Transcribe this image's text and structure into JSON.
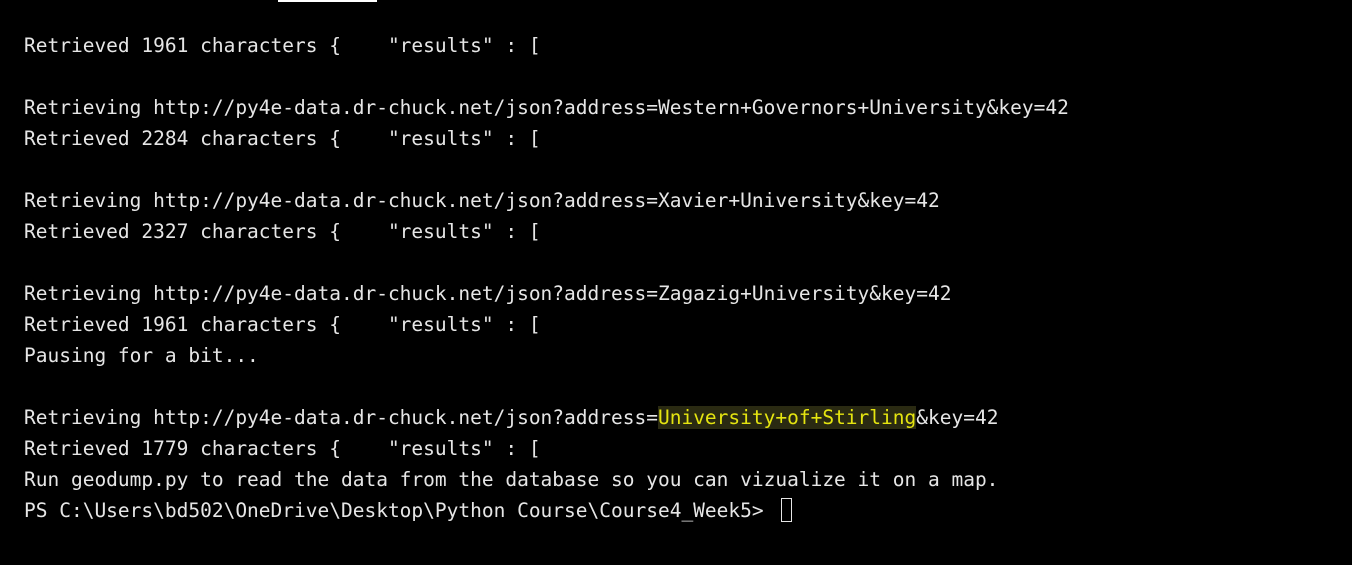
{
  "terminal": {
    "lines": [
      {
        "text": "Retrieved 1961 characters {    \"results\" : ["
      },
      {
        "text": ""
      },
      {
        "text": "Retrieving http://py4e-data.dr-chuck.net/json?address=Western+Governors+University&key=42"
      },
      {
        "text": "Retrieved 2284 characters {    \"results\" : ["
      },
      {
        "text": ""
      },
      {
        "text": "Retrieving http://py4e-data.dr-chuck.net/json?address=Xavier+University&key=42"
      },
      {
        "text": "Retrieved 2327 characters {    \"results\" : ["
      },
      {
        "text": ""
      },
      {
        "text": "Retrieving http://py4e-data.dr-chuck.net/json?address=Zagazig+University&key=42"
      },
      {
        "text": "Retrieved 1961 characters {    \"results\" : ["
      },
      {
        "text": "Pausing for a bit..."
      },
      {
        "text": ""
      },
      {
        "prefix": "Retrieving http://py4e-data.dr-chuck.net/json?address=",
        "highlight": "University+of+Stirling",
        "suffix": "&key=42"
      },
      {
        "text": "Retrieved 1779 characters {    \"results\" : ["
      },
      {
        "text": "Run geodump.py to read the data from the database so you can vizualize it on a map."
      }
    ],
    "prompt": "PS C:\\Users\\bd502\\OneDrive\\Desktop\\Python Course\\Course4_Week5> "
  },
  "colors": {
    "background": "#000000",
    "text": "#e6e6e6",
    "highlight_text": "#e5e510"
  }
}
